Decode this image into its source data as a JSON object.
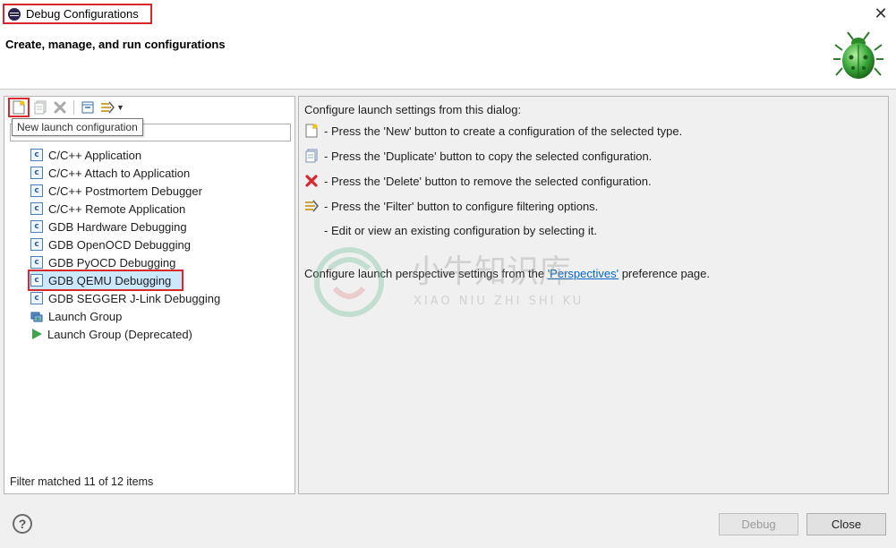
{
  "window": {
    "title": "Debug Configurations",
    "close_glyph": "✕"
  },
  "header": {
    "title": "Create, manage, and run configurations",
    "icon": "bug-icon"
  },
  "toolbar": {
    "buttons": [
      {
        "name": "new-config-button",
        "icon": "new-file-icon"
      },
      {
        "name": "duplicate-config-button",
        "icon": "duplicate-icon"
      },
      {
        "name": "delete-config-button",
        "icon": "delete-icon"
      },
      {
        "name": "collapse-all-button",
        "icon": "collapse-icon"
      },
      {
        "name": "filter-button",
        "icon": "filter-icon"
      }
    ],
    "tooltip": "New launch configuration"
  },
  "filter": {
    "value": "",
    "placeholder": ""
  },
  "tree": {
    "items": [
      {
        "label": "C/C++ Application",
        "icon": "c-icon"
      },
      {
        "label": "C/C++ Attach to Application",
        "icon": "c-icon"
      },
      {
        "label": "C/C++ Postmortem Debugger",
        "icon": "c-icon"
      },
      {
        "label": "C/C++ Remote Application",
        "icon": "c-icon"
      },
      {
        "label": "GDB Hardware Debugging",
        "icon": "c-icon"
      },
      {
        "label": "GDB OpenOCD Debugging",
        "icon": "c-icon"
      },
      {
        "label": "GDB PyOCD Debugging",
        "icon": "c-icon"
      },
      {
        "label": "GDB QEMU Debugging",
        "icon": "c-icon",
        "selected": true
      },
      {
        "label": "GDB SEGGER J-Link Debugging",
        "icon": "c-icon"
      },
      {
        "label": "Launch Group",
        "icon": "launch-group-icon"
      },
      {
        "label": "Launch Group (Deprecated)",
        "icon": "play-icon"
      }
    ]
  },
  "status": "Filter matched 11 of 12 items",
  "right": {
    "intro": "Configure launch settings from this dialog:",
    "lines": [
      "- Press the 'New' button to create a configuration of the selected type.",
      "- Press the 'Duplicate' button to copy the selected configuration.",
      "- Press the 'Delete' button to remove the selected configuration.",
      "- Press the 'Filter' button to configure filtering options.",
      "- Edit or view an existing configuration by selecting it."
    ],
    "perspective_prefix": "Configure launch perspective settings from the ",
    "perspective_link": "'Perspectives'",
    "perspective_suffix": " preference page."
  },
  "watermark": {
    "cn": "小牛知识库",
    "en": "XIAO NIU ZHI SHI KU"
  },
  "buttons": {
    "help": "?",
    "debug": "Debug",
    "close": "Close"
  },
  "colors": {
    "highlight": "#d9272e",
    "link": "#0066cc",
    "selection": "#cce8ff"
  }
}
